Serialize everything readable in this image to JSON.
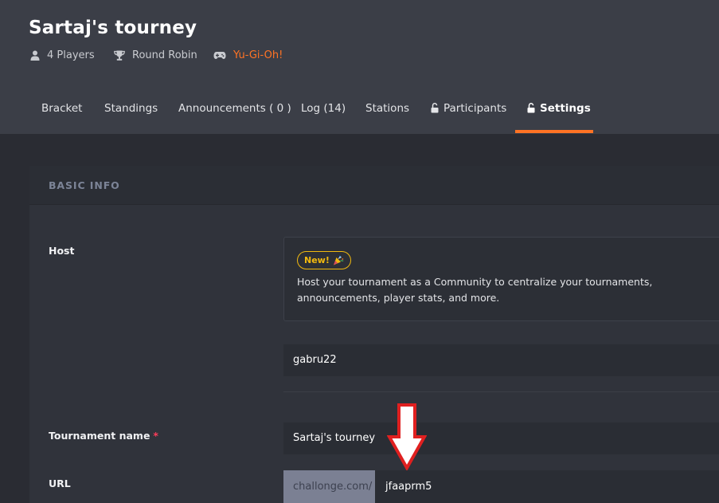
{
  "header": {
    "title": "Sartaj's tourney",
    "players": "4 Players",
    "format": "Round Robin",
    "game": "Yu-Gi-Oh!"
  },
  "tabs": [
    {
      "label": "Bracket",
      "icon": ""
    },
    {
      "label": "Standings",
      "icon": ""
    },
    {
      "label": "Announcements ( 0 )",
      "icon": ""
    },
    {
      "label": "Log (14)",
      "icon": ""
    },
    {
      "label": "Stations",
      "icon": ""
    },
    {
      "label": "Participants",
      "icon": "unlock-icon"
    },
    {
      "label": "Settings",
      "icon": "unlock-icon",
      "active": true
    }
  ],
  "section": {
    "title": "BASIC INFO"
  },
  "host": {
    "label": "Host",
    "badge": "New!",
    "badge_icon": "party-popper-icon",
    "description": "Host your tournament as a Community to centralize your tournaments, announcements, player stats, and more.",
    "value": "gabru22"
  },
  "tournament_name": {
    "label": "Tournament name",
    "required_mark": "*",
    "value": "Sartaj's tourney"
  },
  "url": {
    "label": "URL",
    "prefix": "challonge.com/",
    "value": "jfaaprm5"
  },
  "annotation": {
    "icon": "down-arrow-icon",
    "color": "#e02020"
  },
  "colors": {
    "accent": "#ff7324",
    "badge": "#f1b90f",
    "required": "#ff3d5a"
  }
}
